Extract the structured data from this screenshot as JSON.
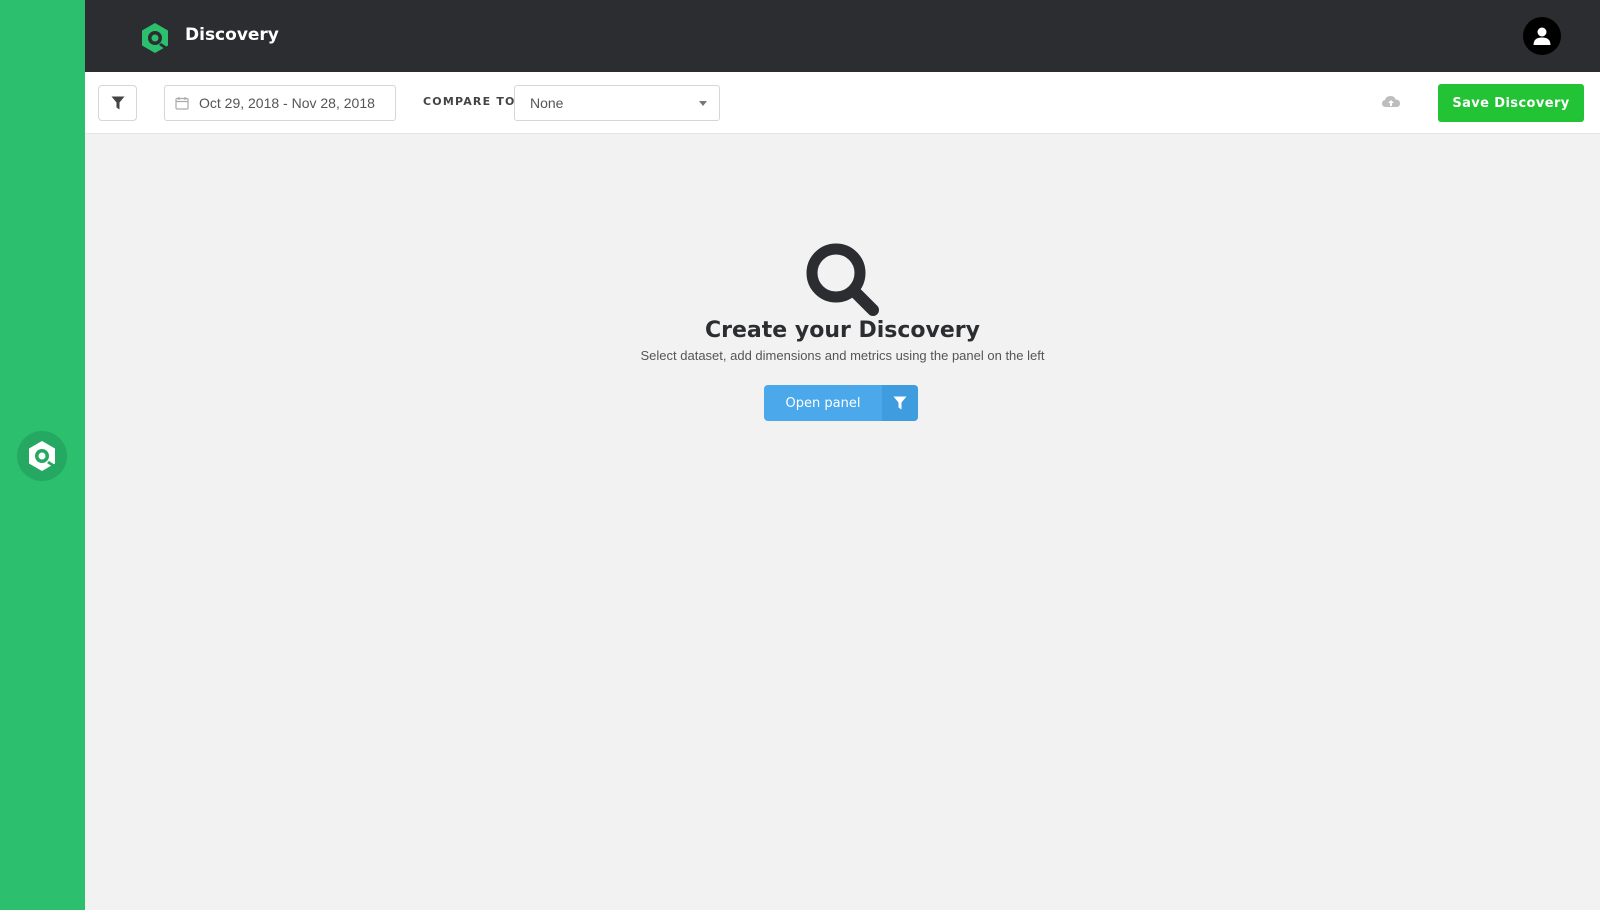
{
  "app": {
    "title": "Discovery",
    "brand_color": "#2bbf6e"
  },
  "sidebar": {
    "logo_icon": "discovery-logo-icon"
  },
  "header": {
    "avatar_icon": "user-icon"
  },
  "toolbar": {
    "filter_icon": "filter-icon",
    "date_range_value": "Oct 29, 2018 - Nov 28, 2018",
    "compare_label": "COMPARE TO",
    "compare_value": "None",
    "cloud_icon": "cloud-icon",
    "save_label": "Save Discovery",
    "save_color": "#22c334"
  },
  "main": {
    "empty_title": "Create your Discovery",
    "empty_subtitle": "Select dataset, add dimensions and metrics using the panel on the left",
    "open_panel_label": "Open panel",
    "open_panel_color": "#4ba8ea"
  }
}
